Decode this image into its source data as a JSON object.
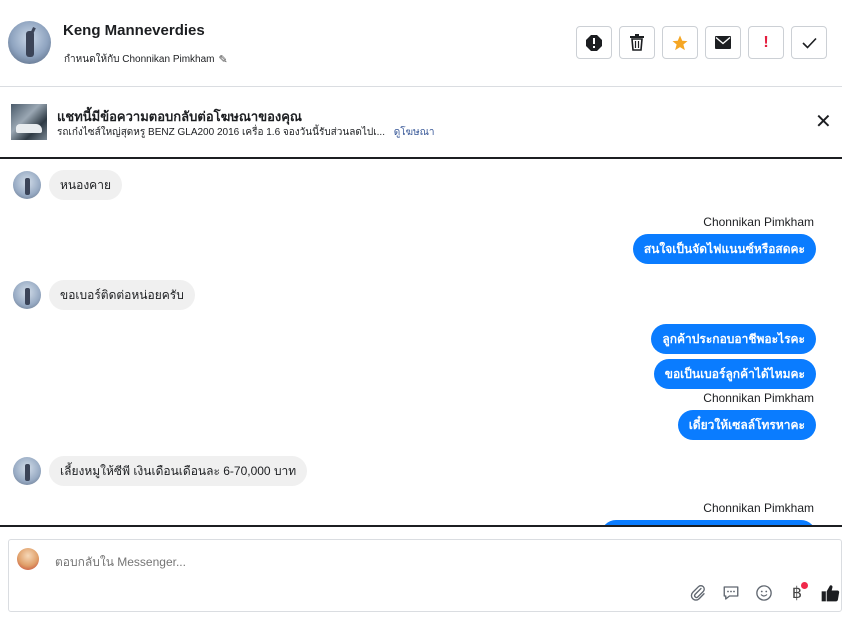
{
  "header": {
    "name": "Keng Manneverdies",
    "assign_text": "กำหนดให้กับ Chonnikan Pimkham",
    "actions": [
      "spam-icon",
      "trash-icon",
      "star-icon",
      "mail-icon",
      "important-icon",
      "check-icon"
    ]
  },
  "ad": {
    "title": "แชทนี้มีข้อความตอบกลับต่อโฆษณาของคุณ",
    "subtitle": "รถเก๋งไซส์ใหญ่สุดหรู BENZ GLA200 2016 เครื่อ 1.6 จองวันนี้รับส่วนลดไปเ...",
    "link": "ดูโฆษณา",
    "close": "✕"
  },
  "messages": {
    "m1": "หนองคาย",
    "s1": "Chonnikan Pimkham",
    "m2": "สนใจเป็นจัดไฟแนนซ์หรือสดคะ",
    "m3": "ขอเบอร์ติดต่อหน่อยครับ",
    "m4": "ลูกค้าประกอบอาชีพอะไรคะ",
    "m5": "ขอเป็นเบอร์ลูกค้าได้ไหมคะ",
    "s2": "Chonnikan Pimkham",
    "m6": "เดี๋ยวให้เซลล์โทรหาคะ",
    "m7": "เลี้ยงหมูให้ซีพี เงินเดือนเดือนละ 6-70,000 บาท",
    "s3": "Chonnikan Pimkham"
  },
  "composer": {
    "placeholder": "ตอบกลับใน Messenger...",
    "tools": [
      "attach-icon",
      "saved-reply-icon",
      "emoji-icon",
      "baht-icon",
      "like-icon"
    ]
  },
  "colors": {
    "accent": "#0a7cff",
    "star": "#f5a623",
    "important": "#e41e3f"
  }
}
